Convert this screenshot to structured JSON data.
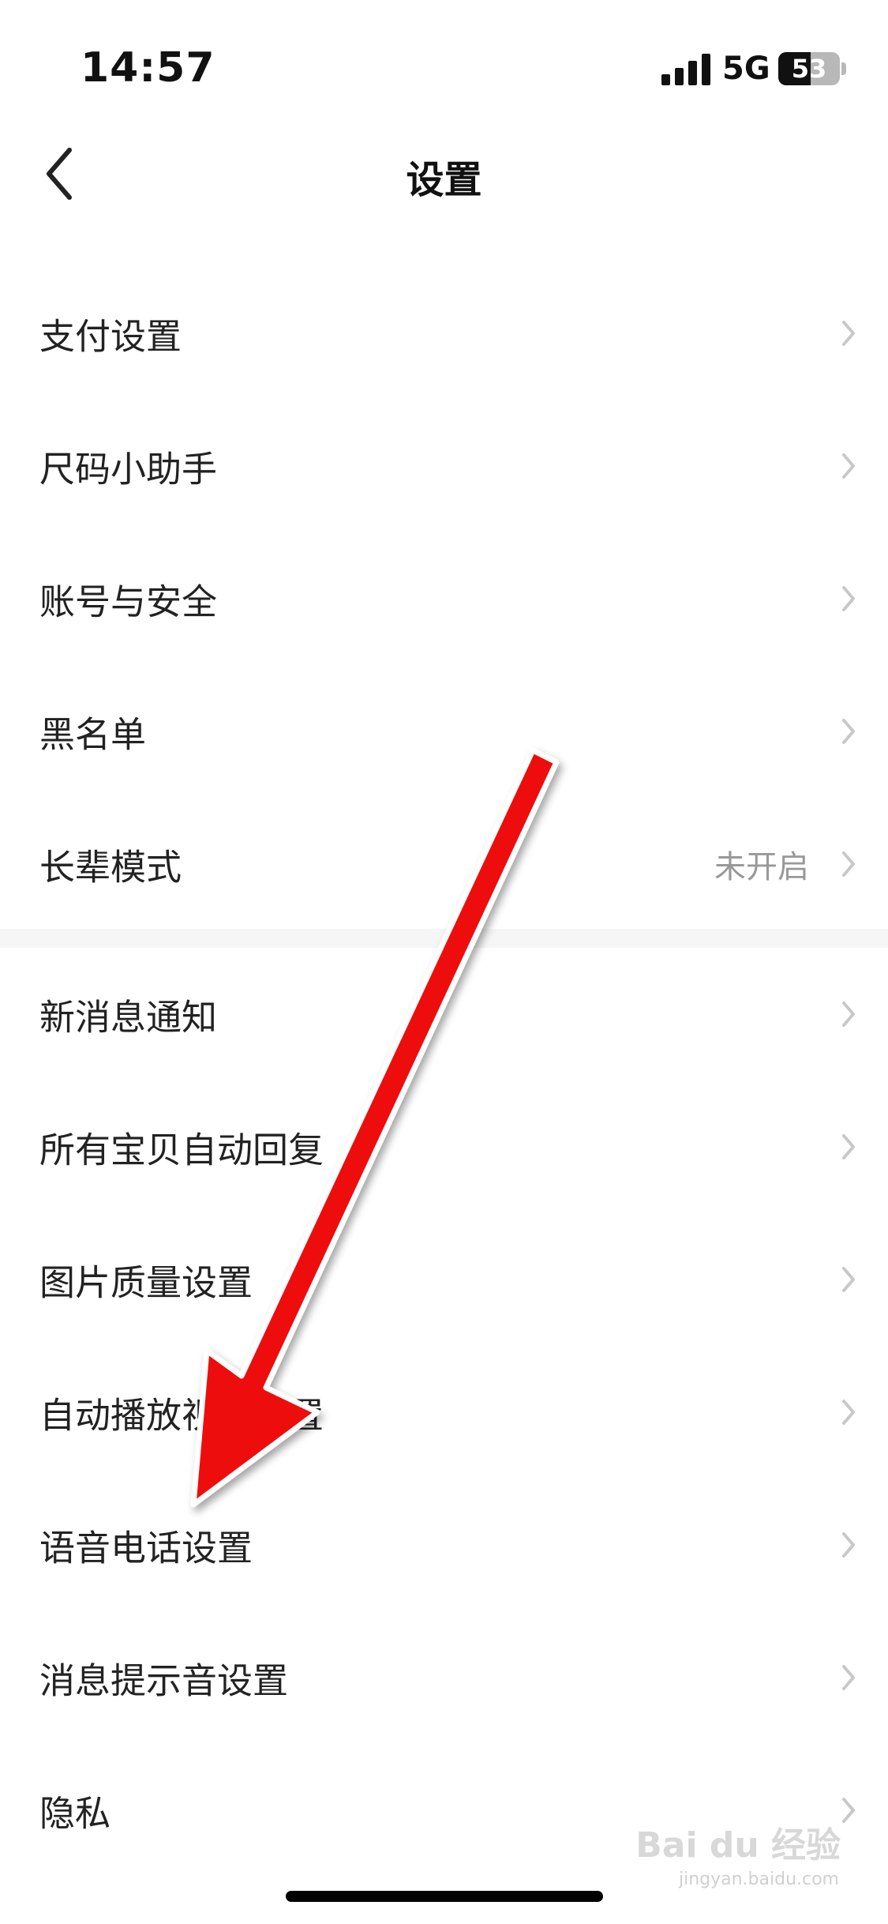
{
  "status_bar": {
    "time": "14:57",
    "network": "5G",
    "battery_level": "53"
  },
  "nav": {
    "title": "设置"
  },
  "sections": [
    {
      "items": [
        {
          "label": "支付设置",
          "value": ""
        },
        {
          "label": "尺码小助手",
          "value": ""
        },
        {
          "label": "账号与安全",
          "value": ""
        },
        {
          "label": "黑名单",
          "value": ""
        },
        {
          "label": "长辈模式",
          "value": "未开启"
        }
      ]
    },
    {
      "items": [
        {
          "label": "新消息通知",
          "value": ""
        },
        {
          "label": "所有宝贝自动回复",
          "value": ""
        },
        {
          "label": "图片质量设置",
          "value": ""
        },
        {
          "label": "自动播放视频设置",
          "value": ""
        },
        {
          "label": "语音电话设置",
          "value": ""
        },
        {
          "label": "消息提示音设置",
          "value": ""
        },
        {
          "label": "隐私",
          "value": ""
        }
      ]
    }
  ],
  "annotation": {
    "arrow_color": "#ee1111"
  },
  "watermark": {
    "brand": "Bai du 经验",
    "url": "jingyan.baidu.com"
  }
}
